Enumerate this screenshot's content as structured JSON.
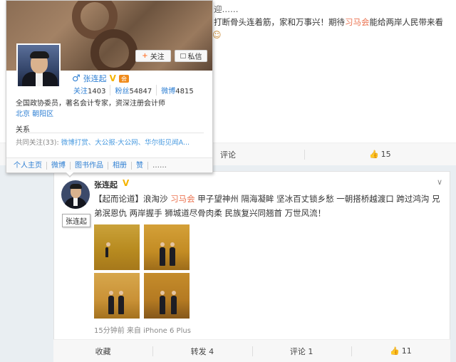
{
  "card1": {
    "line1": "迎……",
    "line2_a": "打断骨头连着筋，家和万事兴！期待",
    "line2_hl": "习马会",
    "line2_b": "能给两岸人民带来看",
    "emoji": "☺",
    "actions": {
      "forward": "",
      "comment": "评论",
      "like": "15"
    }
  },
  "popup": {
    "follow_label": "关注",
    "message_label": "私信",
    "name": "张连起",
    "verified_badge": "V",
    "level_badge": "会",
    "stats": [
      {
        "label": "关注",
        "value": "1403"
      },
      {
        "label": "粉丝",
        "value": "54847"
      },
      {
        "label": "微博",
        "value": "4815"
      }
    ],
    "bio": "全国政协委员，著名会计专家，资深注册会计师",
    "location": "北京 朝阳区",
    "relation_title": "关系",
    "common_label": "共同关注(33):",
    "common_items": "微博打赏、大公报-大公网、华尔街见闻A...",
    "footer": [
      "个人主页",
      "微博",
      "图书作品",
      "相册",
      "赞"
    ],
    "footer_more": "……"
  },
  "card2": {
    "name": "张连起",
    "verified_badge": "V",
    "chevron": "∨",
    "body_a": "【起而论道】浪淘沙 ",
    "body_hl": "习马会",
    "body_b": " 甲子望神州 隔海凝眸 坚冰百丈锁乡愁 一朝搭桥越渡口 跨过鸿沟 兄弟泯恩仇 两岸握手 狮城道尽骨肉柔 民族复兴同翘首 万世风流！",
    "tooltip": "张连起",
    "meta": "15分钟前 来自 iPhone 6 Plus",
    "actions": {
      "collect": "收藏",
      "forward": "转发 4",
      "comment": "评论 1",
      "like": "11"
    }
  },
  "colors": {
    "link": "#2e7fd3",
    "highlight": "#eb7350",
    "verified": "#f5b400"
  },
  "icons": [
    "male-icon",
    "verified-icon",
    "plus-icon",
    "message-icon",
    "thumb-up-icon",
    "chevron-down-icon"
  ]
}
